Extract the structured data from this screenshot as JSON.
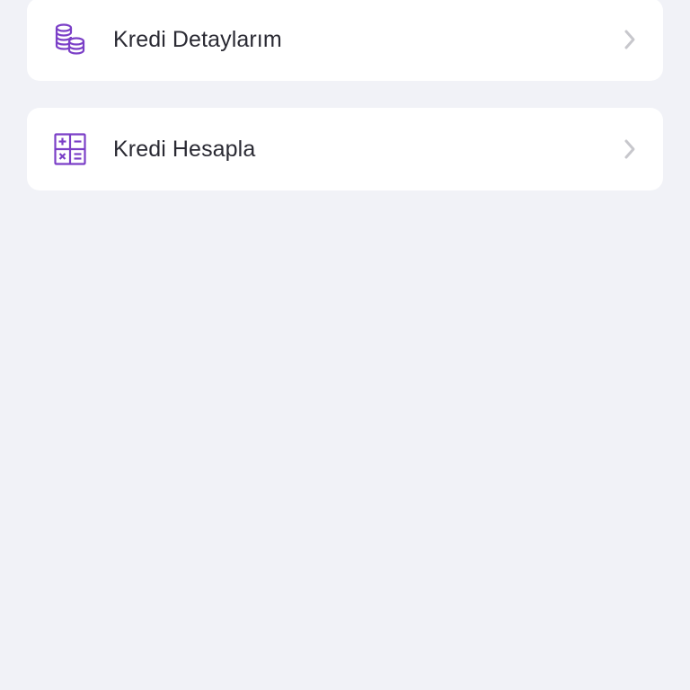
{
  "menu": {
    "items": [
      {
        "label": "Kredi Detaylarım",
        "icon": "coins-stack-icon"
      },
      {
        "label": "Kredi Hesapla",
        "icon": "calculator-icon"
      }
    ]
  },
  "colors": {
    "background": "#f1f2f7",
    "card": "#ffffff",
    "accent": "#7b3fc7",
    "text": "#2a2a33",
    "chevron": "#c7c7cc"
  }
}
